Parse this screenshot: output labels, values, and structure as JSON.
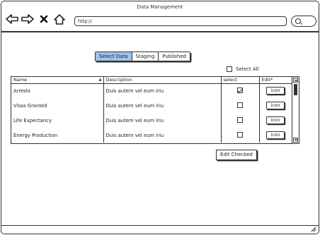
{
  "window": {
    "title": "Data Management"
  },
  "browser": {
    "url": "http://",
    "nav_icons": [
      "arrow-left-icon",
      "arrow-right-icon",
      "close-icon",
      "home-icon",
      "search-icon"
    ]
  },
  "tabs": [
    {
      "label": "Select Data",
      "active": true
    },
    {
      "label": "Staging",
      "active": false
    },
    {
      "label": "Published",
      "active": false
    }
  ],
  "select_all": {
    "label": "Select All",
    "checked": false
  },
  "table": {
    "columns": [
      "Name",
      "Description",
      "select",
      "Edit*"
    ],
    "rows": [
      {
        "name": "Arrests",
        "description": "Duis autem vel eum iriu",
        "selected": true,
        "edit_label": "icon"
      },
      {
        "name": "Visas Granted",
        "description": "Duis autem vel eum iriu",
        "selected": false,
        "edit_label": "icon"
      },
      {
        "name": "Life Expectancy",
        "description": "Duis autem vel eum iriu",
        "selected": false,
        "edit_label": "icon"
      },
      {
        "name": "Energy Production",
        "description": "Duis autem vel eum iriu",
        "selected": false,
        "edit_label": "icon"
      }
    ]
  },
  "actions": {
    "edit_checked": "Edit Checked"
  },
  "colors": {
    "active_tab": "#9dc3ec",
    "stroke": "#333333"
  }
}
